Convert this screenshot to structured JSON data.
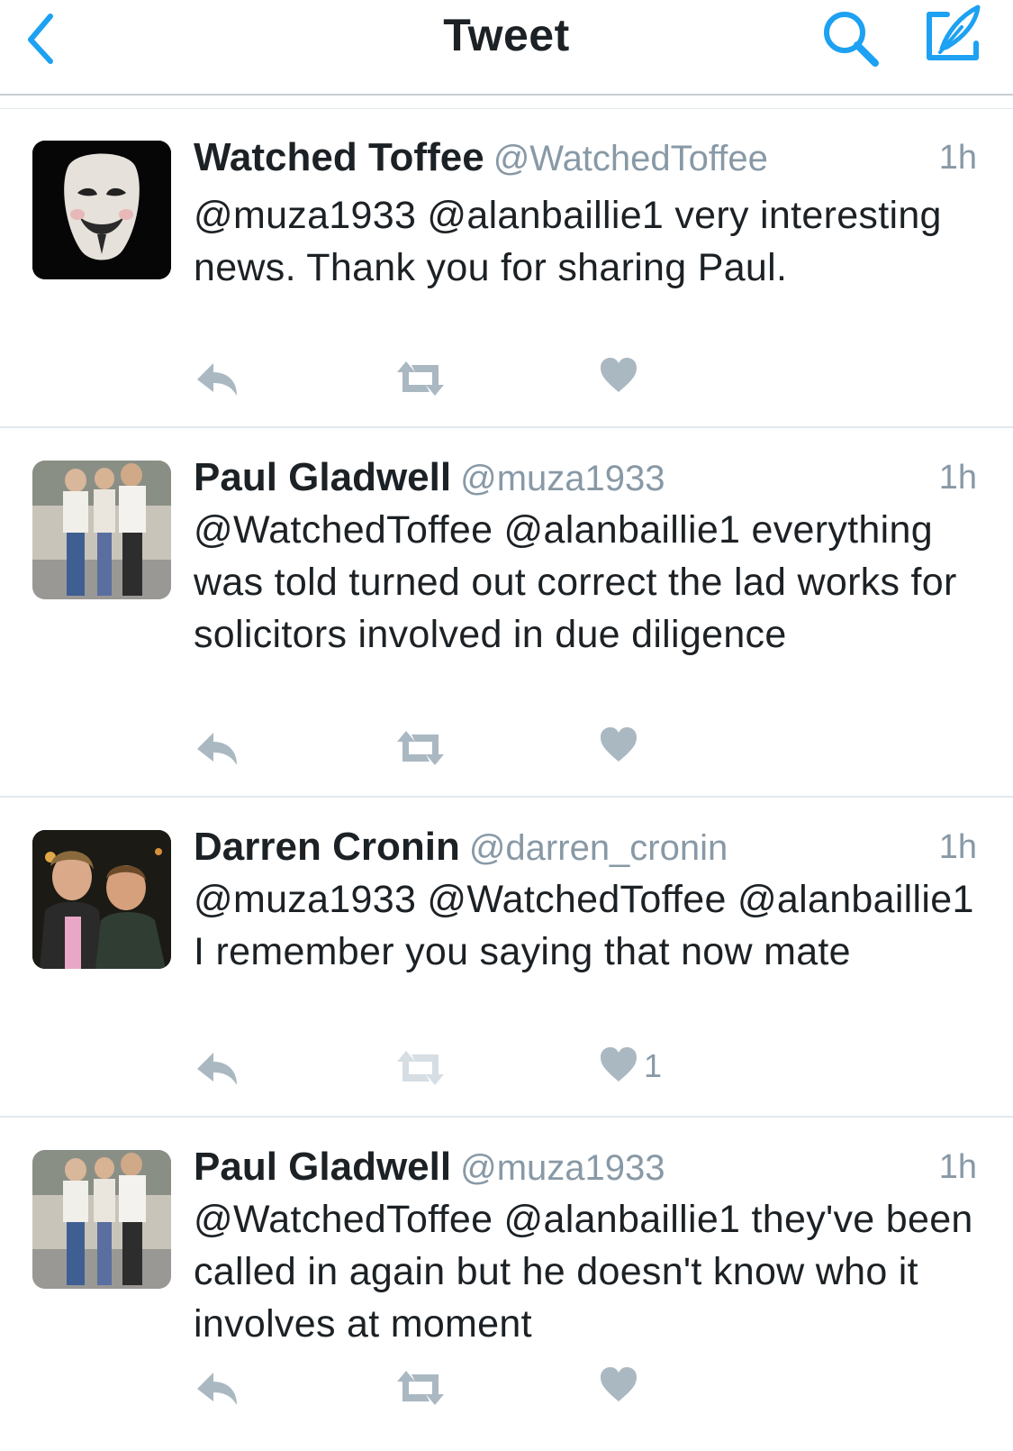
{
  "navbar": {
    "title": "Tweet",
    "back_icon": "chevron-left-icon",
    "search_icon": "search-icon",
    "compose_icon": "compose-icon",
    "accent_color": "#1da1f2"
  },
  "tweets": [
    {
      "name": "Watched Toffee",
      "handle": "@WatchedToffee",
      "time": "1h",
      "text": "@muza1933 @alanbaillie1 very interesting news. Thank you for sharing Paul.",
      "like_count": "",
      "avatar": "mask-avatar"
    },
    {
      "name": "Paul Gladwell",
      "handle": "@muza1933",
      "time": "1h",
      "text": "@WatchedToffee @alanbaillie1 everything was told turned out correct the lad works for solicitors involved in due diligence",
      "like_count": "",
      "avatar": "photo-avatar"
    },
    {
      "name": "Darren Cronin",
      "handle": "@darren_cronin",
      "time": "1h",
      "text": "@muza1933 @WatchedToffee @alanbaillie1 I remember you saying that now mate",
      "like_count": "1",
      "avatar": "photo-avatar"
    },
    {
      "name": "Paul Gladwell",
      "handle": "@muza1933",
      "time": "1h",
      "text": "@WatchedToffee @alanbaillie1 they've been called in again but he doesn't know who it involves at moment",
      "like_count": "",
      "avatar": "photo-avatar"
    }
  ],
  "action_icons": {
    "reply": "reply-icon",
    "retweet": "retweet-icon",
    "like": "heart-icon",
    "icon_color": "#aab8c2"
  }
}
